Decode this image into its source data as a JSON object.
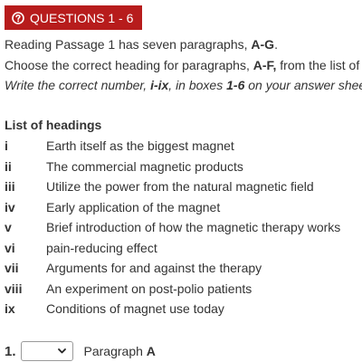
{
  "header": {
    "icon": "question-circle-icon",
    "title": "QUESTIONS 1 - 6",
    "bg_color": "#b71c1c"
  },
  "intro": {
    "line1": {
      "prefix": "Reading Passage 1 has seven paragraphs, ",
      "range": "A-G",
      "suffix": "."
    },
    "line2": {
      "prefix": "Choose the correct heading for paragraphs, ",
      "range": "A-F,",
      "suffix": " from the list of"
    },
    "line3": {
      "prefix": "Write the correct number, ",
      "numbers": "i-ix",
      "middle": ", in boxes ",
      "boxes": "1-6",
      "suffix": " on your answer shee"
    }
  },
  "list_title": "List of headings",
  "headings": [
    {
      "num": "i",
      "text": "Earth itself as the biggest magnet"
    },
    {
      "num": "ii",
      "text": "The commercial magnetic products"
    },
    {
      "num": "iii",
      "text": "Utilize the power from the natural magnetic field"
    },
    {
      "num": "iv",
      "text": "Early application of the magnet"
    },
    {
      "num": "v",
      "text": "Brief introduction of how the magnetic therapy works"
    },
    {
      "num": "vi",
      "text": "pain-reducing effect"
    },
    {
      "num": "vii",
      "text": "Arguments for and against the therapy"
    },
    {
      "num": "viii",
      "text": "An experiment on post-polio patients"
    },
    {
      "num": "ix",
      "text": "Conditions of magnet use today"
    }
  ],
  "answers": [
    {
      "number": "1.",
      "selected": "",
      "label": "Paragraph ",
      "letter": "A"
    }
  ]
}
